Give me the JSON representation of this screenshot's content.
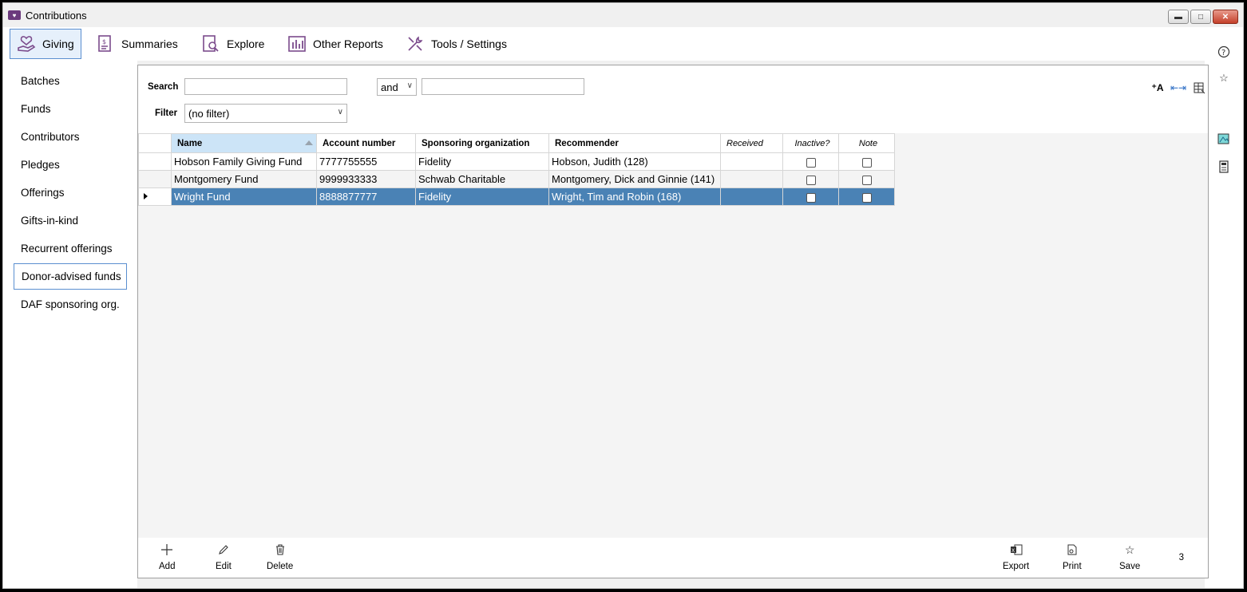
{
  "window": {
    "title": "Contributions"
  },
  "nav": {
    "tabs": [
      {
        "label": "Giving",
        "active": true
      },
      {
        "label": "Summaries"
      },
      {
        "label": "Explore"
      },
      {
        "label": "Other Reports"
      },
      {
        "label": "Tools / Settings"
      }
    ]
  },
  "sidebar": {
    "items": [
      {
        "label": "Batches"
      },
      {
        "label": "Funds"
      },
      {
        "label": "Contributors"
      },
      {
        "label": "Pledges"
      },
      {
        "label": "Offerings"
      },
      {
        "label": "Gifts-in-kind"
      },
      {
        "label": "Recurrent offerings"
      },
      {
        "label": "Donor-advised funds",
        "active": true
      },
      {
        "label": "DAF sponsoring org."
      }
    ]
  },
  "search": {
    "label": "Search",
    "value": "",
    "conjunction": "and",
    "second_value": "",
    "filter_label": "Filter",
    "filter_value": "(no filter)"
  },
  "grid": {
    "columns": [
      "Name",
      "Account number",
      "Sponsoring organization",
      "Recommender",
      "Received",
      "Inactive?",
      "Note"
    ],
    "rows": [
      {
        "name": "Hobson Family Giving Fund",
        "account": "7777755555",
        "org": "Fidelity",
        "recommender": "Hobson, Judith (128)",
        "received": "",
        "inactive": false,
        "note": false
      },
      {
        "name": "Montgomery Fund",
        "account": "9999933333",
        "org": "Schwab Charitable",
        "recommender": "Montgomery, Dick and Ginnie (141)",
        "received": "",
        "inactive": false,
        "note": false
      },
      {
        "name": "Wright Fund",
        "account": "8888877777",
        "org": "Fidelity",
        "recommender": "Wright, Tim and Robin (168)",
        "received": "",
        "inactive": false,
        "note": false,
        "selected": true
      }
    ]
  },
  "bottom": {
    "add": "Add",
    "edit": "Edit",
    "delete": "Delete",
    "export": "Export",
    "print": "Print",
    "save": "Save",
    "count": "3"
  }
}
